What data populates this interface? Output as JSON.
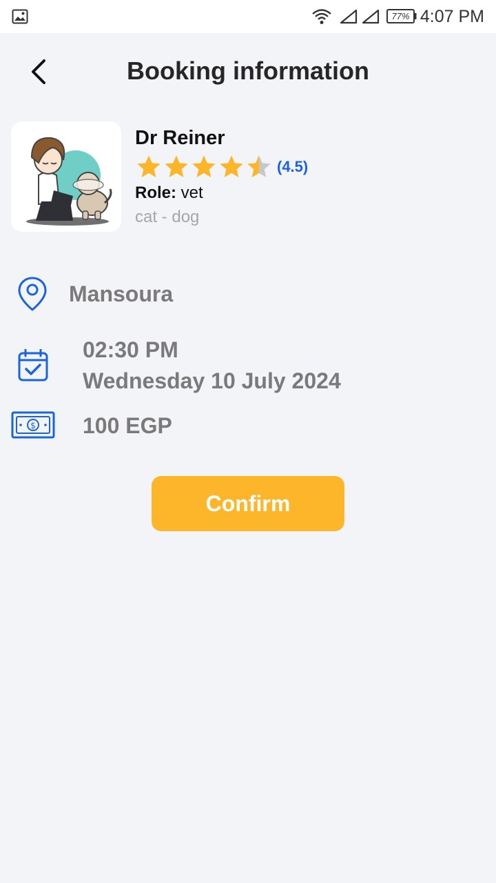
{
  "status_bar": {
    "battery": "77%",
    "time": "4:07 PM"
  },
  "header": {
    "title": "Booking information"
  },
  "doctor": {
    "name": "Dr Reiner",
    "rating": 4.5,
    "rating_label": "(4.5)",
    "role_label": "Role:",
    "role_value": "vet",
    "species": "cat - dog"
  },
  "details": {
    "location": "Mansoura",
    "time": "02:30 PM",
    "date": "Wednesday 10 July 2024",
    "price": "100 EGP"
  },
  "actions": {
    "confirm_label": "Confirm"
  },
  "colors": {
    "background": "#f2f4f8",
    "accent_blue": "#1a63e0",
    "star": "#fdb52a",
    "star_empty": "#c8c8c8",
    "button": "#fdb52a"
  },
  "icons": {
    "back": "chevron-left-icon",
    "location": "location-pin-icon",
    "calendar": "calendar-check-icon",
    "money": "banknote-icon"
  }
}
